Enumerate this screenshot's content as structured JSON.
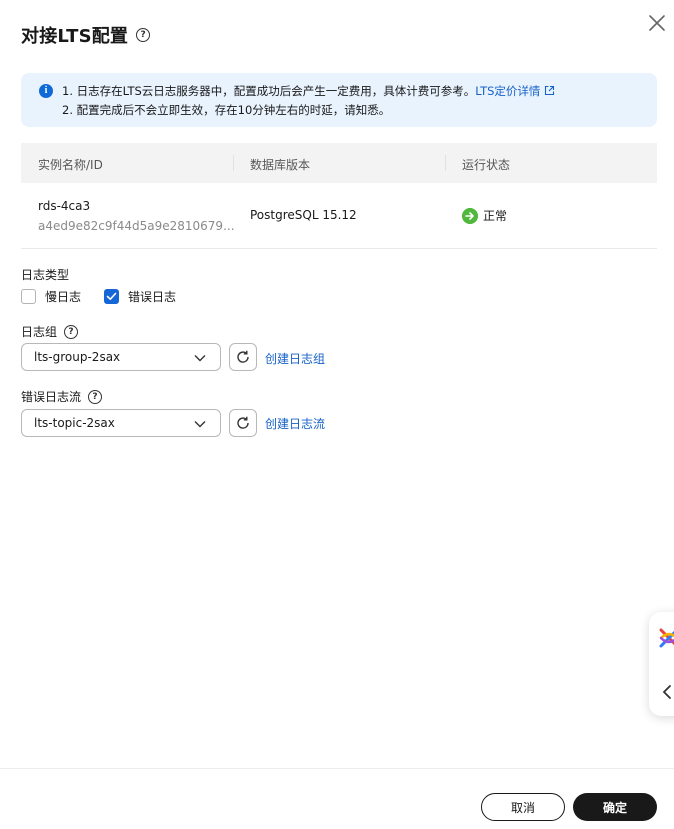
{
  "dialog": {
    "title": "对接LTS配置",
    "help": "?"
  },
  "notice": {
    "line1_text": "1. 日志存在LTS云日志服务器中，配置成功后会产生一定费用，具体计费可参考。",
    "line1_link": "LTS定价详情",
    "line2_text": "2. 配置完成后不会立即生效，存在10分钟左右的时延，请知悉。",
    "icon": "i"
  },
  "table": {
    "headers": [
      "实例名称/ID",
      "数据库版本",
      "运行状态"
    ],
    "row": {
      "name": "rds-4ca3",
      "id": "a4ed9e82c9f44d5a9e2810679...",
      "version": "PostgreSQL 15.12",
      "status": "正常"
    }
  },
  "log_type": {
    "label": "日志类型",
    "options": [
      {
        "label": "慢日志",
        "checked": false
      },
      {
        "label": "错误日志",
        "checked": true
      }
    ]
  },
  "log_group": {
    "label": "日志组",
    "value": "lts-group-2sax",
    "create_link": "创建日志组"
  },
  "log_stream": {
    "label": "错误日志流",
    "value": "lts-topic-2sax",
    "create_link": "创建日志流"
  },
  "footer": {
    "cancel": "取消",
    "confirm": "确定"
  },
  "colors": {
    "accent": "#1566d6",
    "link": "#1561c9",
    "success": "#50b83c",
    "notice_bg": "#e9f3fe"
  },
  "icons": [
    "help-icon",
    "close-icon",
    "info-icon",
    "external-link-icon",
    "success-icon",
    "chevron-down-icon",
    "refresh-icon",
    "checkmark-icon",
    "assistant-logo-icon",
    "chevron-left-icon"
  ]
}
